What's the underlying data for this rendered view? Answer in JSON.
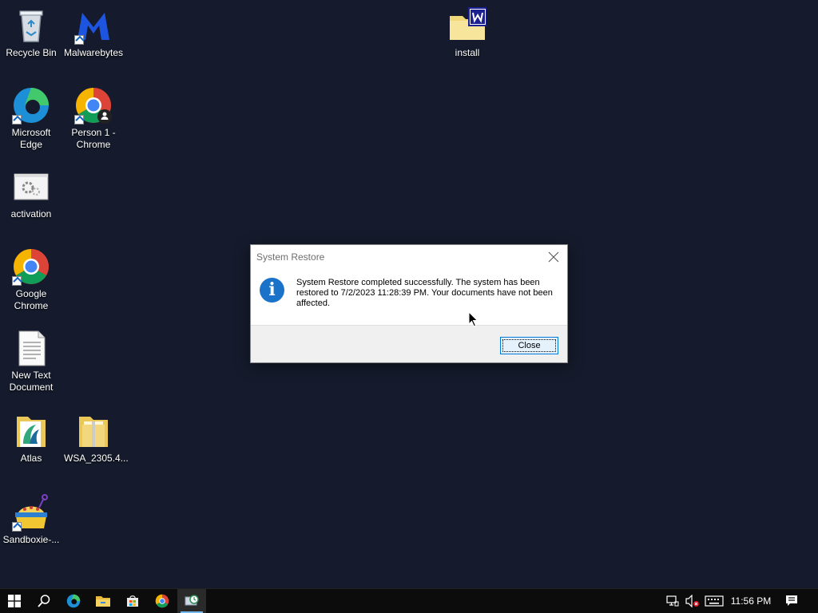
{
  "desktop": {
    "icons": [
      {
        "label": "Recycle Bin"
      },
      {
        "label": "Malwarebytes"
      },
      {
        "label": "install"
      },
      {
        "label": "Microsoft Edge"
      },
      {
        "label": "Person 1 - Chrome"
      },
      {
        "label": "activation"
      },
      {
        "label": "Google Chrome"
      },
      {
        "label": "New Text Document"
      },
      {
        "label": "Atlas"
      },
      {
        "label": "WSA_2305.4..."
      },
      {
        "label": "Sandboxie-..."
      }
    ]
  },
  "dialog": {
    "title": "System Restore",
    "message": "System Restore completed successfully. The system has been restored to 7/2/2023 11:28:39 PM. Your documents have not been affected.",
    "close_button": "Close",
    "icon": "info-icon"
  },
  "taskbar": {
    "pinned": [
      "windows-start-icon",
      "search-icon",
      "edge-icon",
      "file-explorer-icon",
      "store-icon",
      "chrome-icon",
      "system-restore-icon"
    ],
    "clock": "11:56 PM"
  },
  "colors": {
    "desktop_background": "#151b2c",
    "accent": "#0078d7",
    "info_icon": "#1a73c9"
  }
}
